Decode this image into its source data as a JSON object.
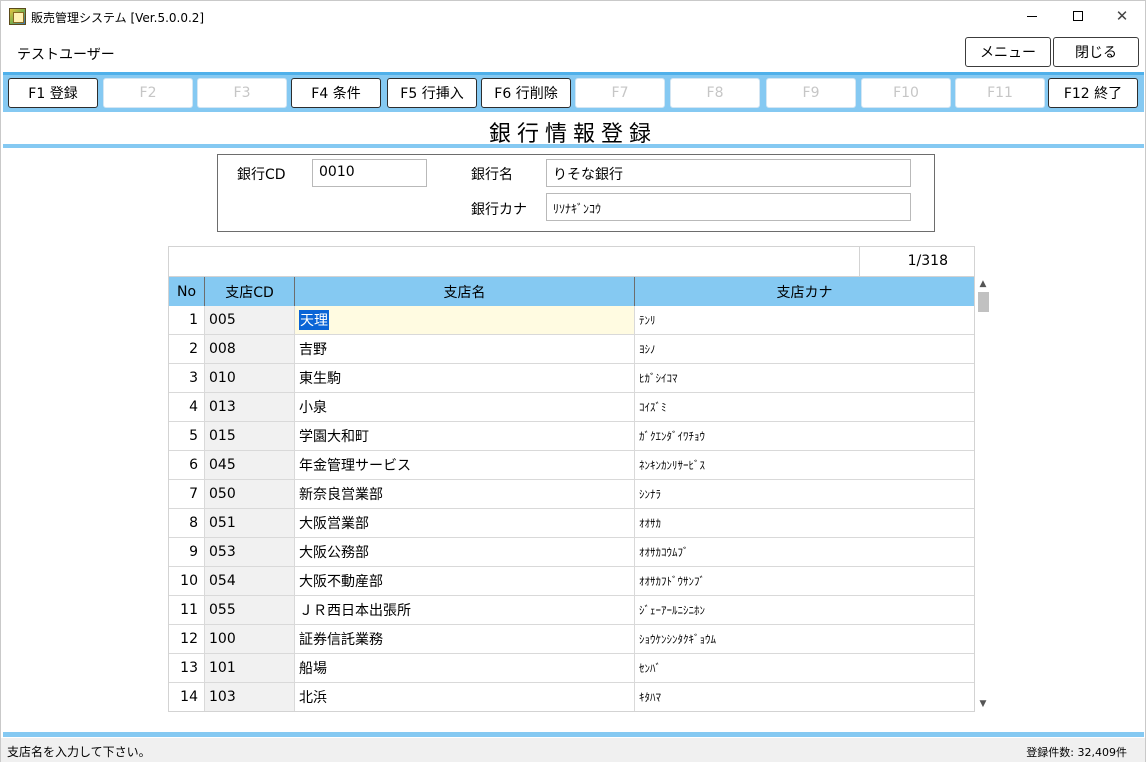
{
  "window": {
    "title": "販売管理システム [Ver.5.0.0.2]",
    "icon": "app-icon",
    "controls": [
      "minimize-icon",
      "maximize-icon",
      "close-icon"
    ],
    "close_glyph": "✕"
  },
  "header": {
    "user": "テストユーザー",
    "menu_label": "メニュー",
    "close_label": "閉じる"
  },
  "fkeys": [
    {
      "label": "F1 登録",
      "enabled": true
    },
    {
      "label": "F2",
      "enabled": false
    },
    {
      "label": "F3",
      "enabled": false
    },
    {
      "label": "F4 条件",
      "enabled": true
    },
    {
      "label": "F5 行挿入",
      "enabled": true
    },
    {
      "label": "F6 行削除",
      "enabled": true
    },
    {
      "label": "F7",
      "enabled": false
    },
    {
      "label": "F8",
      "enabled": false
    },
    {
      "label": "F9",
      "enabled": false
    },
    {
      "label": "F10",
      "enabled": false
    },
    {
      "label": "F11",
      "enabled": false
    },
    {
      "label": "F12 終了",
      "enabled": true
    }
  ],
  "page_title": "銀行情報登録",
  "bank": {
    "cd_label": "銀行CD",
    "cd_value": "0010",
    "name_label": "銀行名",
    "name_value": "りそな銀行",
    "kana_label": "銀行カナ",
    "kana_value": "ﾘｿﾅｷﾞﾝｺｳ"
  },
  "grid": {
    "page_indicator": "1/318",
    "columns": [
      "No",
      "支店CD",
      "支店名",
      "支店カナ"
    ],
    "active_row": 0,
    "rows": [
      {
        "no": "1",
        "cd": "005",
        "name": "天理",
        "kana": "ﾃﾝﾘ"
      },
      {
        "no": "2",
        "cd": "008",
        "name": "吉野",
        "kana": "ﾖｼﾉ"
      },
      {
        "no": "3",
        "cd": "010",
        "name": "東生駒",
        "kana": "ﾋｶﾞｼｲｺﾏ"
      },
      {
        "no": "4",
        "cd": "013",
        "name": "小泉",
        "kana": "ｺｲｽﾞﾐ"
      },
      {
        "no": "5",
        "cd": "015",
        "name": "学園大和町",
        "kana": "ｶﾞｸｴﾝﾀﾞｲﾜﾁｮｳ"
      },
      {
        "no": "6",
        "cd": "045",
        "name": "年金管理サービス",
        "kana": "ﾈﾝｷﾝｶﾝﾘｻｰﾋﾞｽ"
      },
      {
        "no": "7",
        "cd": "050",
        "name": "新奈良営業部",
        "kana": "ｼﾝﾅﾗ"
      },
      {
        "no": "8",
        "cd": "051",
        "name": "大阪営業部",
        "kana": "ｵｵｻｶ"
      },
      {
        "no": "9",
        "cd": "053",
        "name": "大阪公務部",
        "kana": "ｵｵｻｶｺｳﾑﾌﾞ"
      },
      {
        "no": "10",
        "cd": "054",
        "name": "大阪不動産部",
        "kana": "ｵｵｻｶﾌﾄﾞｳｻﾝﾌﾞ"
      },
      {
        "no": "11",
        "cd": "055",
        "name": "ＪＲ西日本出張所",
        "kana": "ｼﾞｪｰｱｰﾙﾆｼﾆﾎﾝ"
      },
      {
        "no": "12",
        "cd": "100",
        "name": "証券信託業務",
        "kana": "ｼｮｳｹﾝｼﾝﾀｸｷﾞｮｳﾑ"
      },
      {
        "no": "13",
        "cd": "101",
        "name": "船場",
        "kana": "ｾﾝﾊﾞ"
      },
      {
        "no": "14",
        "cd": "103",
        "name": "北浜",
        "kana": "ｷﾀﾊﾏ"
      }
    ]
  },
  "status": {
    "message": "支店名を入力して下さい。",
    "count": "登録件数: 32,409件"
  },
  "colors": {
    "accent": "#85c9f2",
    "accent_dark": "#4fb0ea",
    "selection": "#0a64d6",
    "active_cell": "#fffbe1"
  }
}
